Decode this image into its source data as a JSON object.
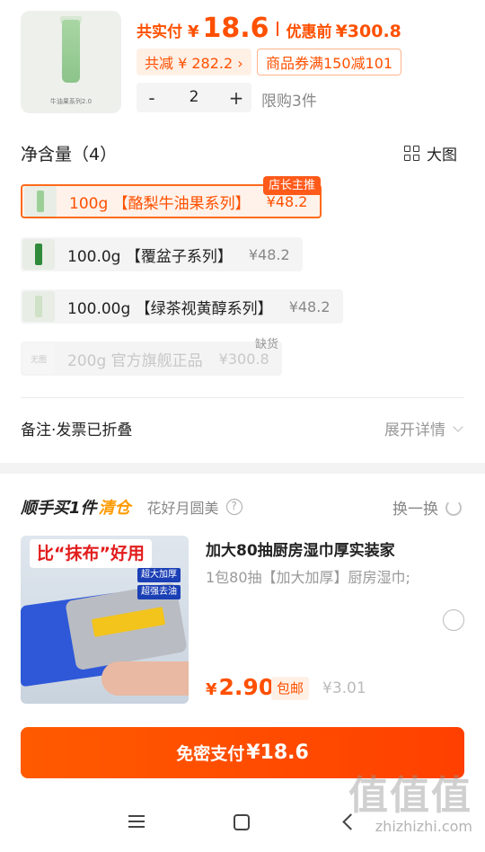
{
  "product": {
    "thumb_text": "牛油果系列2.0",
    "paid_label": "共实付",
    "currency": "¥",
    "paid_value": "18.6",
    "before_label": "优惠前",
    "before_value": "¥300.8",
    "saved": "共减 ¥ 282.2 ›",
    "coupon": "商品券满150减101",
    "qty_minus": "-",
    "quantity": "2",
    "qty_plus": "+",
    "limit": "限购3件"
  },
  "spec": {
    "title": "净含量（4）",
    "bigpic_label": "大图",
    "owner_tag": "店长主推",
    "out_of_stock": "缺货",
    "options": [
      {
        "name": "100g 【酪梨牛油果系列】",
        "price": "¥48.2"
      },
      {
        "name": "100.0g 【覆盆子系列】",
        "price": "¥48.2"
      },
      {
        "name": "100.00g 【绿茶视黄醇系列】",
        "price": "¥48.2"
      },
      {
        "name": "200g 官方旗舰正品",
        "price": "¥300.8",
        "swatch_text": "无图"
      }
    ]
  },
  "notes": {
    "label": "备注·发票已折叠",
    "expand": "展开详情"
  },
  "addon": {
    "title": "顺手买1件",
    "clear": "清仓",
    "subtitle": "花好月圆美",
    "help": "?",
    "swap": "换一换",
    "image_banner": "比“抹布”好用",
    "badge1": "超大加厚",
    "badge2": "超强去油",
    "name": "加大80抽厨房湿巾厚实装家",
    "desc": "1包80抽【加大加厚】厨房湿巾;",
    "price_yen": "¥",
    "price": "2.90",
    "shipping": "包邮",
    "orig_price": "¥3.01"
  },
  "pay": {
    "label": "免密支付",
    "amount": "¥18.6"
  },
  "watermark": {
    "top": "值值值",
    "bottom": "zhizhizhi.com"
  },
  "colors": {
    "accent": "#ff5000",
    "clear_tag": "#ff9a00"
  },
  "icons": {
    "nav": [
      "menu-icon",
      "home-icon",
      "back-icon"
    ],
    "grid": "grid-icon",
    "refresh": "refresh-icon"
  }
}
